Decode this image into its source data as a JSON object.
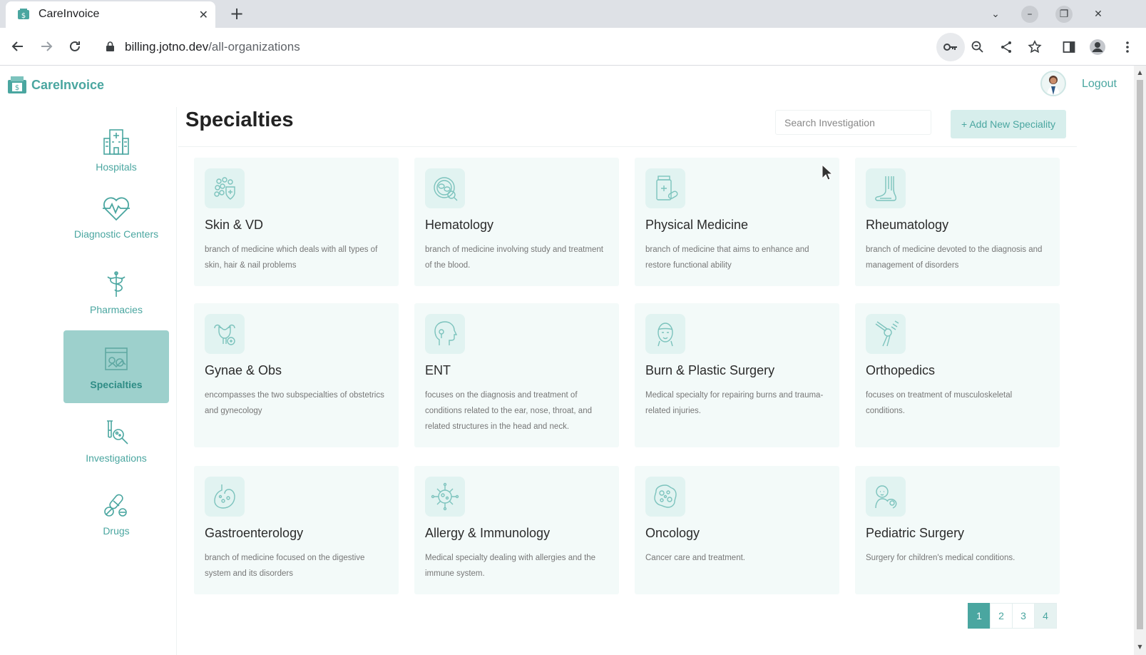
{
  "browser": {
    "tab_title": "CareInvoice",
    "url_host": "billing.jotno.dev",
    "url_path": "/all-organizations"
  },
  "app": {
    "brand": "CareInvoice",
    "logout_label": "Logout",
    "accent_color": "#4aa6a0"
  },
  "sidebar": {
    "items": [
      {
        "label": "Hospitals",
        "icon": "hospital-icon"
      },
      {
        "label": "Diagnostic Centers",
        "icon": "heartbeat-icon"
      },
      {
        "label": "Pharmacies",
        "icon": "caduceus-icon"
      },
      {
        "label": "Specialties",
        "icon": "specialties-icon",
        "active": true
      },
      {
        "label": "Investigations",
        "icon": "microscope-icon"
      },
      {
        "label": "Drugs",
        "icon": "pills-icon"
      }
    ]
  },
  "main": {
    "title": "Specialties",
    "search_placeholder": "Search Investigation",
    "add_button": "+ Add New Speciality"
  },
  "specialties": [
    {
      "title": "Skin & VD",
      "desc": "branch of medicine which deals with all types of skin, hair & nail problems",
      "icon": "skin-cells-icon"
    },
    {
      "title": "Hematology",
      "desc": "branch of medicine involving study and treatment of the blood.",
      "icon": "blood-cell-icon"
    },
    {
      "title": "Physical Medicine",
      "desc": "branch of medicine that aims to enhance and restore functional ability",
      "icon": "medicine-bottle-icon"
    },
    {
      "title": "Rheumatology",
      "desc": "branch of medicine devoted to the diagnosis and management of disorders",
      "icon": "foot-joint-icon"
    },
    {
      "title": "Gynae & Obs",
      "desc": "encompasses the two subspecialties of obstetrics and gynecology",
      "icon": "uterus-icon"
    },
    {
      "title": "ENT",
      "desc": "focuses on the diagnosis and treatment of conditions related to the ear, nose, throat, and related structures in the head and neck.",
      "icon": "head-profile-icon"
    },
    {
      "title": "Burn & Plastic Surgery",
      "desc": "Medical specialty for repairing burns and trauma-related injuries.",
      "icon": "face-icon"
    },
    {
      "title": "Orthopedics",
      "desc": "focuses on treatment of musculoskeletal conditions.",
      "icon": "knee-bone-icon"
    },
    {
      "title": "Gastroenterology",
      "desc": "branch of medicine focused on the digestive system and its disorders",
      "icon": "stomach-icon"
    },
    {
      "title": "Allergy & Immunology",
      "desc": "Medical specialty dealing with allergies and the immune system.",
      "icon": "virus-icon"
    },
    {
      "title": "Oncology",
      "desc": "Cancer care and treatment.",
      "icon": "cancer-cell-icon"
    },
    {
      "title": "Pediatric Surgery",
      "desc": "Surgery for children's medical conditions.",
      "icon": "baby-icon"
    }
  ],
  "pagination": {
    "pages": [
      "1",
      "2",
      "3",
      "4"
    ],
    "current": "1"
  }
}
